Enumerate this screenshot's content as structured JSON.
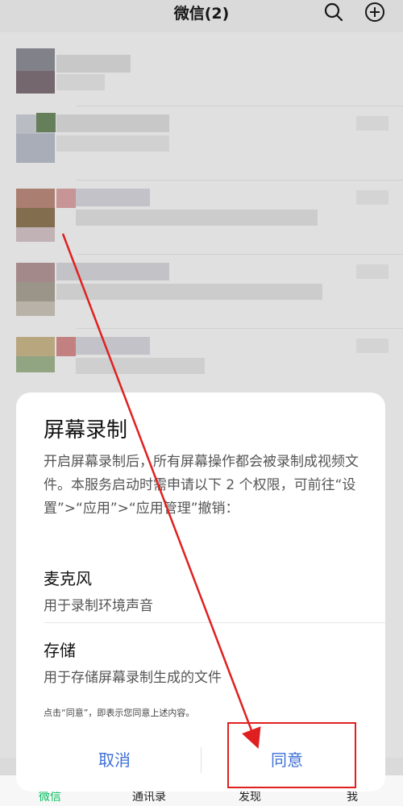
{
  "header": {
    "title": "微信(2)",
    "search_icon": "search-icon",
    "add_icon": "plus-circle-icon"
  },
  "tabs": [
    {
      "label": "微信",
      "active": true
    },
    {
      "label": "通讯录",
      "active": false
    },
    {
      "label": "发现",
      "active": false
    },
    {
      "label": "我",
      "active": false
    }
  ],
  "dialog": {
    "title": "屏幕录制",
    "description": "开启屏幕录制后，所有屏幕操作都会被录制成视频文件。本服务启动时需申请以下 2 个权限，可前往“设置”>“应用”>“应用管理”撤销：",
    "permissions": [
      {
        "name": "麦克风",
        "desc": "用于录制环境声音"
      },
      {
        "name": "存储",
        "desc": "用于存储屏幕录制生成的文件"
      }
    ],
    "notice": "点击“同意”，即表示您同意上述内容。",
    "cancel_label": "取消",
    "agree_label": "同意"
  },
  "colors": {
    "accent": "#07c160",
    "dialog_button": "#3d6fd6",
    "annotation": "#e02020"
  }
}
